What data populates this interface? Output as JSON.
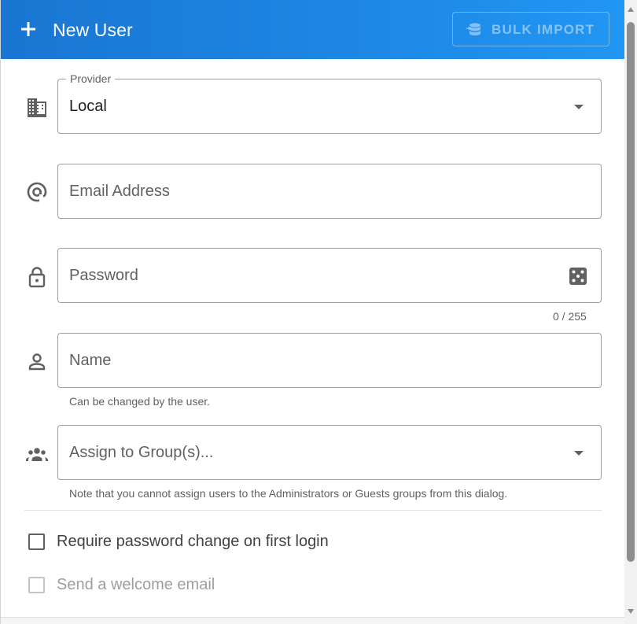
{
  "header": {
    "title": "New User",
    "add_icon": "plus-icon",
    "bulk_import_label": "BULK IMPORT",
    "bulk_import_icon": "database-import-icon",
    "bulk_import_disabled": true
  },
  "provider": {
    "label": "Provider",
    "value": "Local",
    "icon": "domain-icon"
  },
  "email": {
    "placeholder": "Email Address",
    "icon": "at-icon"
  },
  "password": {
    "placeholder": "Password",
    "icon": "lock-icon",
    "generate_icon": "dice-icon",
    "counter": "0 / 255"
  },
  "name": {
    "placeholder": "Name",
    "icon": "account-icon",
    "hint": "Can be changed by the user."
  },
  "groups": {
    "placeholder": "Assign to Group(s)...",
    "icon": "account-group-icon",
    "hint": "Note that you cannot assign users to the Administrators or Guests groups from this dialog."
  },
  "options": {
    "require_password_change": {
      "label": "Require password change on first login",
      "checked": false,
      "disabled": false
    },
    "send_welcome_email": {
      "label": "Send a welcome email",
      "checked": false,
      "disabled": true
    }
  },
  "colors": {
    "header_start": "#1976d2",
    "header_end": "#2196f3",
    "field_border": "#9e9e9e",
    "icon_gray": "#616161"
  }
}
